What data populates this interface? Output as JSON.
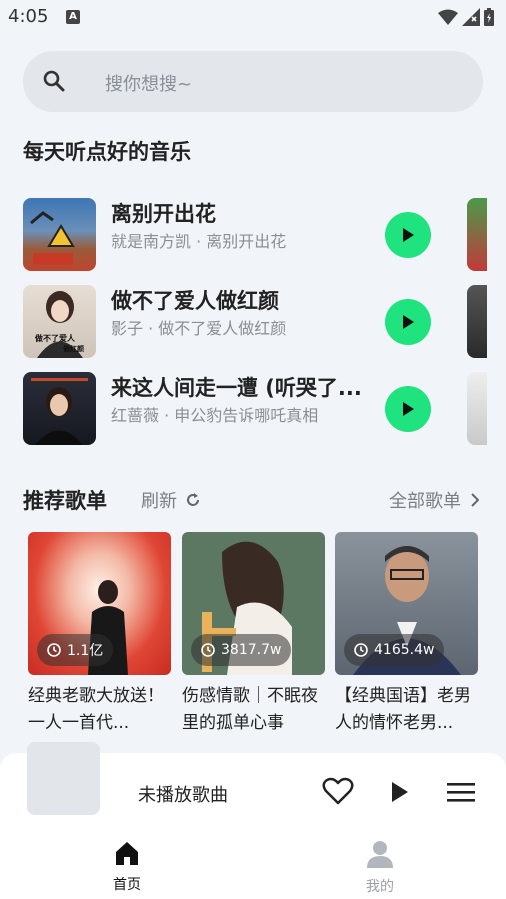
{
  "status": {
    "time": "4:05",
    "a_icon": "A"
  },
  "search": {
    "placeholder": "搜你想搜~"
  },
  "daily": {
    "title": "每天听点好的音乐",
    "songs": [
      {
        "name": "离别开出花",
        "artist": "就是南方凯 · 离别开出花",
        "cover_color": "#3d6fa8"
      },
      {
        "name": "做不了爱人做红颜",
        "artist": "影子 · 做不了爱人做红颜",
        "cover_color": "#d8d0c8",
        "cover_text": "做不了爱人\n做红颜"
      },
      {
        "name": "来这人间走一遭 (听哭了...",
        "artist": "红蔷薇 · 申公豹告诉哪吒真相",
        "cover_color": "#2a2a36"
      }
    ]
  },
  "recommend": {
    "title": "推荐歌单",
    "refresh": "刷新",
    "all": "全部歌单",
    "playlists": [
      {
        "count": "1.1亿",
        "title": "经典老歌大放送！一人一首代...",
        "color": "#d8362c"
      },
      {
        "count": "3817.7w",
        "title": "伤感情歌｜不眠夜里的孤单心事",
        "color": "#5d7a62"
      },
      {
        "count": "4165.4w",
        "title": "【经典国语】老男人的情怀老男...",
        "color": "#6c7580"
      }
    ]
  },
  "player": {
    "now_playing": "未播放歌曲"
  },
  "tabs": {
    "home": "首页",
    "mine": "我的"
  },
  "colors": {
    "accent": "#1ee37e",
    "background": "#f1f4f8"
  }
}
